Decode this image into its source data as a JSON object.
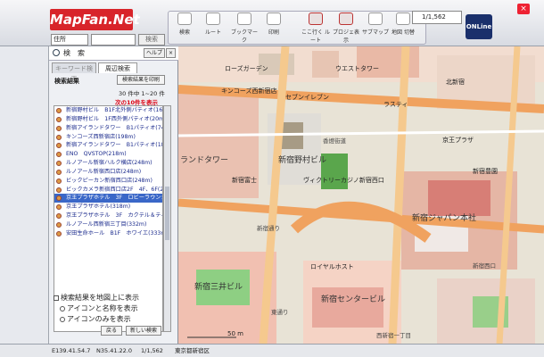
{
  "app": {
    "logo": "MapFan.Net"
  },
  "search_bar": {
    "address_select": "住所",
    "search_button": "検索"
  },
  "toolbar": {
    "buttons": [
      "検索",
      "ルート",
      "ブックマーク",
      "印刷",
      "ここ行く ルート",
      "プロジェ表示",
      "サブマップ",
      "地図 切替"
    ],
    "scale": "1/1,562",
    "online": "ONLine"
  },
  "panel": {
    "title": "検　索",
    "help": "ヘルプ",
    "close": "×",
    "tabs": [
      "キーワード検索",
      "周辺検索"
    ],
    "results_label": "検索結果",
    "open_results": "検索結果を印刷",
    "range": "30 件中 1~20 件",
    "next": "次の10件を表示",
    "items": [
      "新宿野村ビル　B1F北外側パティオ(16m)",
      "新宿野村ビル　1F西外側パティオ(20m)",
      "新宿アイランドタワー　B1パティオ(74m)",
      "キンコーズ西新宿店(198m)",
      "新宿アイランドタワー　B1パティオ(187m)",
      "ENO　QVSTOP(218m)",
      "ルノアール新宿ハルク横店(248m)",
      "ルノアール新宿西口店(248m)",
      "ビックピーカン新宿西口店(248m)",
      "ビックカメラ新宿西口店2F　4F、6F(258m)",
      "京王プラザホテル　3F　ロビーラウンジ(325m)",
      "京王プラザホテル(318m)",
      "京王プラザホテル　3F　カクテル＆ティーラウンジ(318m)",
      "ルノアール西新宿三丁目(332m)",
      "安田生命ホール　B1F　ホワイエ(333m)"
    ],
    "selected_index": 10,
    "options": [
      "検索結果を地図上に表示",
      "アイコンと名称を表示",
      "アイコンのみを表示"
    ],
    "back_button": "戻る",
    "new_search_button": "新しい検索"
  },
  "map": {
    "labels": [
      "ローズガーデン",
      "ウエストタワー",
      "キンコーズ西新宿店",
      "新宿野村ビル",
      "香燈街道",
      "ランドタワー",
      "北新宿",
      "新宿富士",
      "新宿ジャパン本社",
      "新宿豊園",
      "新宿三井ビル",
      "新宿センタービル",
      "ロイヤルホスト",
      "新宿西口",
      "西新宿一丁目",
      "京王プラザ",
      "新宿通り",
      "東通り",
      "ヴィクトリーカジノ新宿西口",
      "セブンイレブン",
      "ラスティ"
    ],
    "scale_label": "50 m"
  },
  "status": {
    "coords_e": "E139.41.54.7",
    "coords_n": "N35.41.22.0",
    "scale": "1/1,562",
    "area": "東京都新宿区"
  }
}
